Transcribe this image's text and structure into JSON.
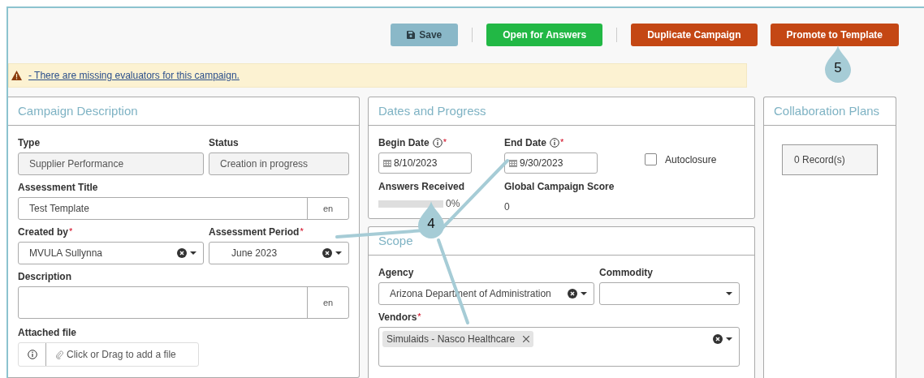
{
  "toolbar": {
    "buttons": [
      {
        "label": "Save",
        "kind": "save"
      },
      {
        "label": "Open for Answers",
        "kind": "open"
      },
      {
        "label": "Duplicate Campaign",
        "kind": "duplicate"
      },
      {
        "label": "Promote to Template",
        "kind": "promote"
      }
    ]
  },
  "warning": {
    "text": "- There are missing evaluators for this campaign."
  },
  "campaign_description": {
    "title": "Campaign Description",
    "type": {
      "label": "Type",
      "value": "Supplier Performance"
    },
    "status": {
      "label": "Status",
      "value": "Creation in progress"
    },
    "assessment_title": {
      "label": "Assessment Title",
      "value": "Test Template",
      "lang": "en"
    },
    "created_by": {
      "label": "Created by",
      "required_mark": "*",
      "value": "MVULA Sullynna"
    },
    "assessment_period": {
      "label": "Assessment Period",
      "required_mark": "*",
      "value": "June 2023"
    },
    "description": {
      "label": "Description",
      "lang": "en"
    },
    "attached_file": {
      "label": "Attached file",
      "placeholder": "Click or Drag to add a file"
    }
  },
  "dates_and_progress": {
    "title": "Dates and Progress",
    "begin_date": {
      "label": "Begin Date",
      "required_mark": "*",
      "value": "8/10/2023"
    },
    "end_date": {
      "label": "End Date",
      "required_mark": "*",
      "value": "9/30/2023"
    },
    "autoclosure": {
      "label": "Autoclosure",
      "checked": false
    },
    "answers_received": {
      "label": "Answers Received",
      "level": 0,
      "reading": "0%"
    },
    "global_campaign_score": {
      "label": "Global Campaign Score",
      "value": "0"
    }
  },
  "scope": {
    "title": "Scope",
    "agency": {
      "label": "Agency",
      "value": "Arizona Department of Administration"
    },
    "commodity": {
      "label": "Commodity"
    },
    "vendors": {
      "label": "Vendors",
      "required_mark": "*",
      "tags": [
        "Simulaids - Nasco Healthcare"
      ]
    }
  },
  "collaboration_plans": {
    "title": "Collaboration Plans",
    "records": "0 Record(s)"
  },
  "callouts": [
    {
      "number": "4",
      "kind": "multi"
    },
    {
      "number": "5",
      "kind": "single"
    }
  ]
}
